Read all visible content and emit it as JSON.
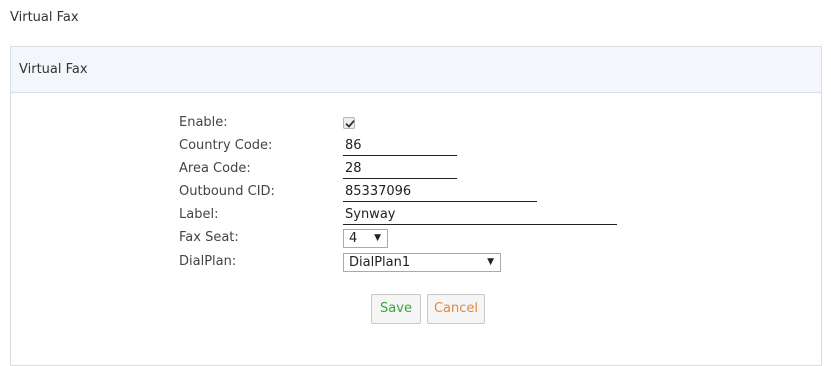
{
  "page": {
    "title": "Virtual Fax"
  },
  "panel": {
    "header": "Virtual Fax"
  },
  "form": {
    "enable": {
      "label": "Enable:",
      "checked": true
    },
    "country_code": {
      "label": "Country Code:",
      "value": "86"
    },
    "area_code": {
      "label": "Area Code:",
      "value": "28"
    },
    "outbound_cid": {
      "label": "Outbound CID:",
      "value": "85337096"
    },
    "label_field": {
      "label": "Label:",
      "value": "Synway"
    },
    "fax_seat": {
      "label": "Fax Seat:",
      "value": "4"
    },
    "dialplan": {
      "label": "DialPlan:",
      "value": "DialPlan1"
    }
  },
  "buttons": {
    "save": "Save",
    "cancel": "Cancel"
  },
  "colors": {
    "save_text": "#3aa53a",
    "cancel_text": "#e08a3c",
    "panel_header_bg": "#f3f6fa"
  },
  "icons": {
    "checkbox": "checkmark-icon",
    "select_arrow": "triangle-down-icon"
  }
}
